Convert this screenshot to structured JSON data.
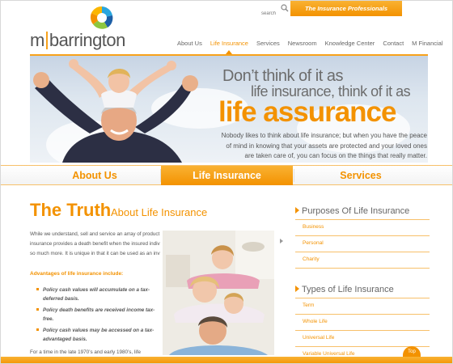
{
  "header": {
    "logo_m": "m",
    "logo_name": "barrington",
    "search_placeholder": "search",
    "tagline": "The Insurance Professionals"
  },
  "nav": {
    "items": [
      "About Us",
      "Life Insurance",
      "Services",
      "Newsroom",
      "Knowledge Center",
      "Contact",
      "M Financial"
    ],
    "active": "Life Insurance"
  },
  "hero": {
    "line1": "Don’t think of it as",
    "line2": "life insurance, think of it as",
    "line3": "life assurance",
    "body": "Nobody likes to think about life insurance; but when you have the peace of mind in knowing that your assets are protected and your loved ones are taken care of, you can focus on the things that really matter."
  },
  "tabs": [
    "About Us",
    "Life Insurance",
    "Services"
  ],
  "main": {
    "heading": "The Truth",
    "subheading": "About Life Insurance",
    "para1_lines": [
      "While we understand, sell and service an array of product",
      "insurance provides a death benefit when the insured indiv",
      "so much more. It is unique in that it can be used as an inv"
    ],
    "advantages_heading": "Advantages of life insurance include:",
    "advantages": [
      "Policy cash values will accumulate on a tax-deferred basis.",
      "Policy death benefits are received income tax-free.",
      "Policy cash values may be accessed on a tax-advantaged basis."
    ],
    "para2": "For a time in the late 1970’s and early 1980’s, life"
  },
  "sidebar": {
    "section1_title": "Purposes Of Life Insurance",
    "section1_links": [
      "Business",
      "Personal",
      "Charity"
    ],
    "section2_title": "Types of Life Insurance",
    "section2_links": [
      "Term",
      "Whole Life",
      "Universal Life",
      "Variable Universal Life"
    ]
  },
  "footer": {
    "top_label": "Top"
  },
  "colors": {
    "accent": "#f39200",
    "accent_light": "#f9b233",
    "text": "#555555"
  }
}
